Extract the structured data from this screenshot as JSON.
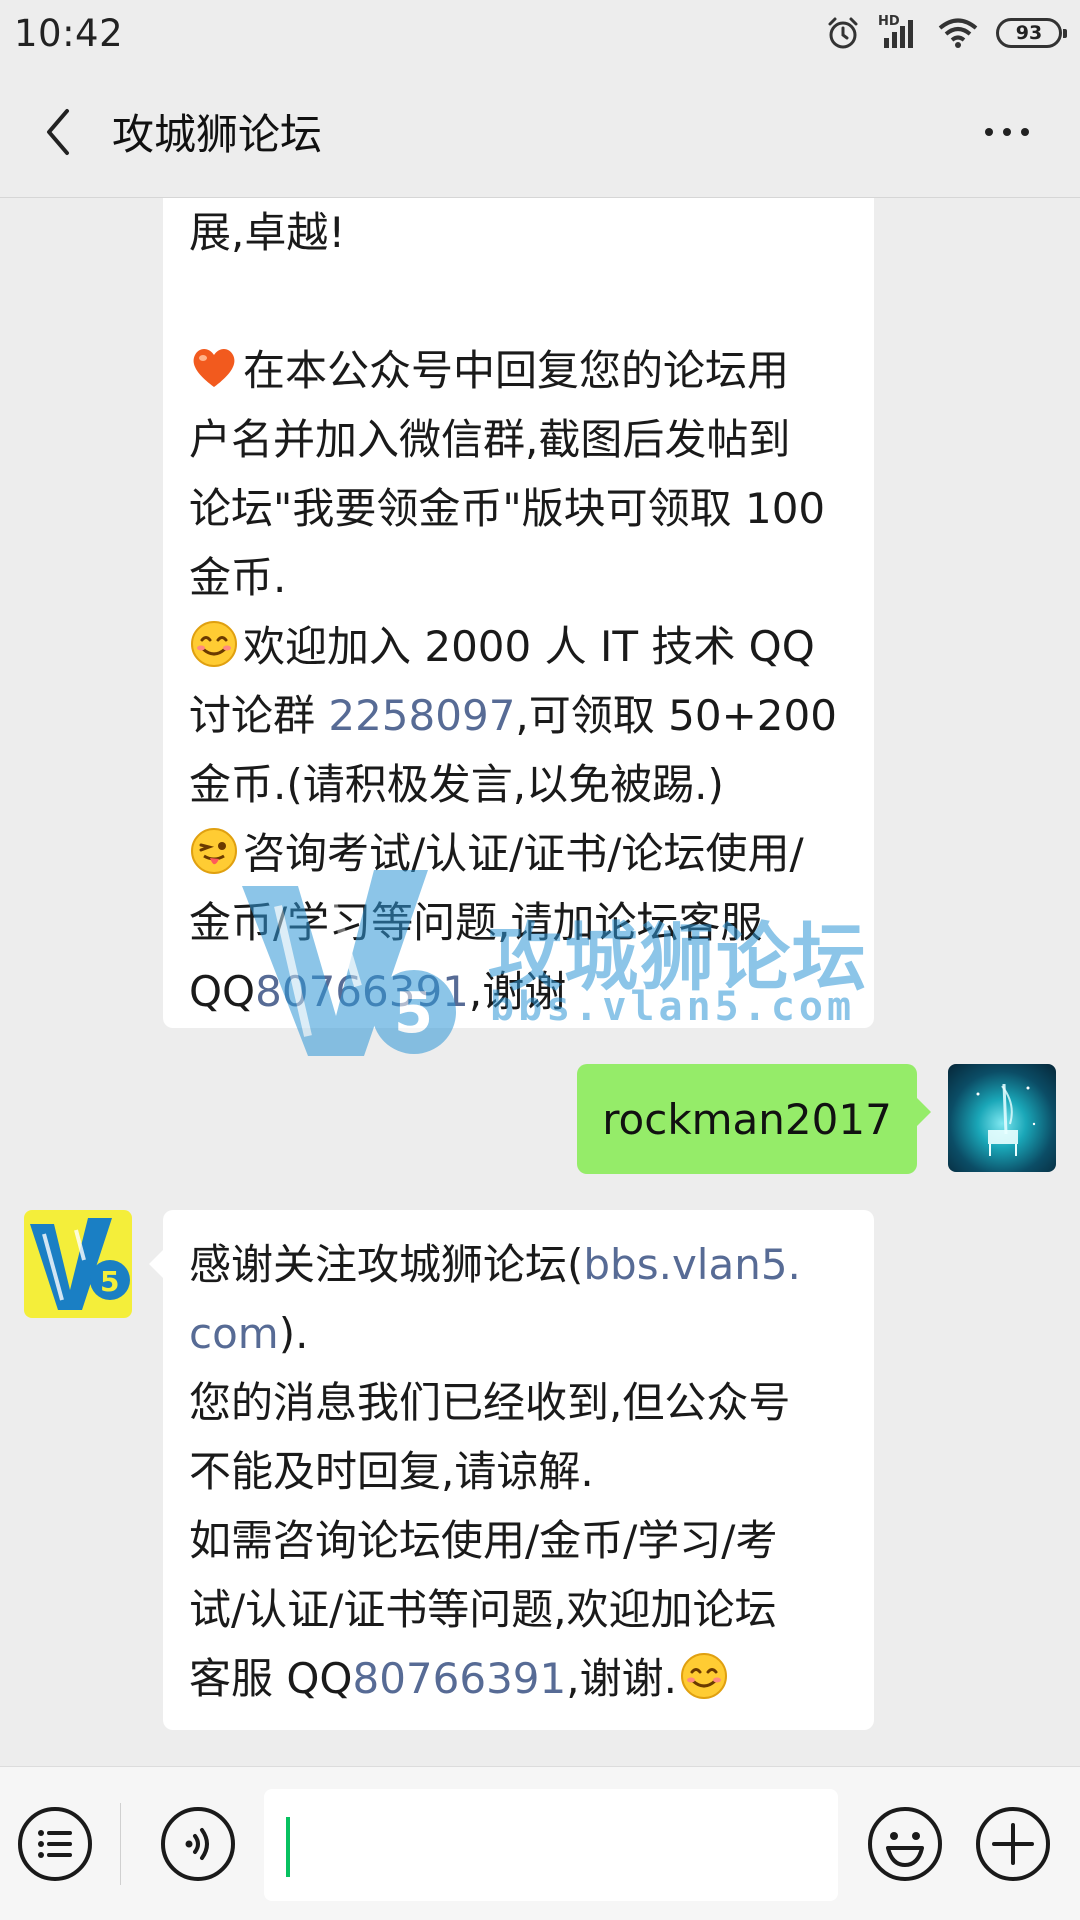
{
  "status_bar": {
    "time": "10:42",
    "network_label": "HD",
    "battery": "93",
    "icons": [
      "alarm-icon",
      "signal-icon",
      "wifi-icon",
      "battery-icon"
    ]
  },
  "nav": {
    "back_icon": "chevron-left-icon",
    "title": "攻城狮论坛",
    "more_icon": "more-dots-icon"
  },
  "messages": {
    "msg1": {
      "line1": "展,卓越!",
      "l3": "在本公众号中回复您的论坛用",
      "l4": "户名并加入微信群,截图后发帖到",
      "l5": "论坛\"我要领金币\"版块可领取 100",
      "l6": "金币.",
      "l7": "欢迎加入 2000 人 IT 技术 QQ",
      "l8_a": "讨论群 ",
      "l8_link": "2258097",
      "l8_b": ",可领取 50+200",
      "l9": "金币.(请积极发言,以免被踢.)",
      "l10": "咨询考试/认证/证书/论坛使用/",
      "l11": "金币/学习等问题,请加论坛客服",
      "l12_a": "QQ",
      "l12_link": "80766391",
      "l12_b": ",谢谢"
    },
    "msg2": {
      "text": "rockman2017"
    },
    "msg3": {
      "l1_a": "感谢关注攻城狮论坛(",
      "l1_link": "bbs.vlan5.",
      "l2_link": "com",
      "l2_b": ").",
      "l3": "您的消息我们已经收到,但公众号",
      "l4": "不能及时回复,请谅解.",
      "l5": "如需咨询论坛使用/金币/学习/考",
      "l6": "试/认证/证书等问题,欢迎加论坛",
      "l7_a": "客服 QQ",
      "l7_link": "80766391",
      "l7_b": ",谢谢."
    }
  },
  "watermark": {
    "title": "攻城狮论坛",
    "url": "bbs.vlan5.com"
  },
  "input_bar": {
    "menu_icon": "menu-list-icon",
    "voice_icon": "voice-icon",
    "emoji_icon": "emoji-icon",
    "plus_icon": "plus-icon",
    "input_value": ""
  },
  "colors": {
    "link": "#576b95",
    "my_bubble": "#95ec69",
    "background": "#ededed",
    "caret": "#07c160"
  }
}
